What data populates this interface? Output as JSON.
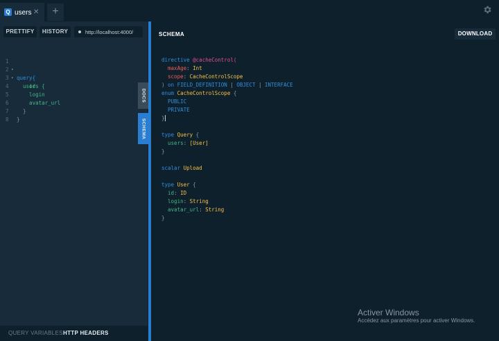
{
  "tabs": [
    {
      "badge": "Q",
      "title": "users",
      "close": "✕"
    }
  ],
  "add_tab": "+",
  "toolbar": {
    "prettify": "PRETTIFY",
    "history": "HISTORY",
    "url": "http://localhost:4000/"
  },
  "query_lines": [
    {
      "n": "1",
      "fold": "▾",
      "text": "query{"
    },
    {
      "n": "2",
      "fold": "▾",
      "text": "  users {"
    },
    {
      "n": "3",
      "fold": "",
      "text": "    id"
    },
    {
      "n": "4",
      "fold": "",
      "text": "    login"
    },
    {
      "n": "5",
      "fold": "",
      "text": "    avatar_url"
    },
    {
      "n": "6",
      "fold": "",
      "text": "  }"
    },
    {
      "n": "7",
      "fold": "",
      "text": "}"
    },
    {
      "n": "8",
      "fold": "",
      "text": ""
    }
  ],
  "bottom": {
    "query_variables": "QUERY VARIABLES",
    "http_headers": "HTTP HEADERS"
  },
  "side_tabs": {
    "docs": "DOCS",
    "schema": "SCHEMA"
  },
  "schema_panel": {
    "title": "SCHEMA",
    "download": "DOWNLOAD"
  },
  "sdl": {
    "directive_kw": "directive",
    "directive_name": "@cacheControl(",
    "arg1": "maxAge",
    "arg1_type": "Int",
    "arg2": "scope",
    "arg2_type": "CacheControlScope",
    "on_line_close": ")",
    "on_kw": "on",
    "loc1": "FIELD_DEFINITION",
    "sep": "|",
    "loc2": "OBJECT",
    "loc3": "INTERFACE",
    "enum_kw": "enum",
    "enum_name": "CacheControlScope",
    "open": "{",
    "close": "}",
    "enum_v1": "PUBLIC",
    "enum_v2": "PRIVATE",
    "type_kw": "type",
    "query_type": "Query",
    "users_field": "users",
    "users_type": "[User]",
    "scalar_kw": "scalar",
    "scalar_name": "Upload",
    "user_type": "User",
    "f_id": "id",
    "f_id_type": "ID",
    "f_login": "login",
    "f_login_type": "String",
    "f_avatar": "avatar_url",
    "f_avatar_type": "String",
    "colon": ":"
  },
  "watermark": {
    "title": "Activer Windows",
    "subtitle": "Accédez aux paramètres pour activer Windows."
  }
}
